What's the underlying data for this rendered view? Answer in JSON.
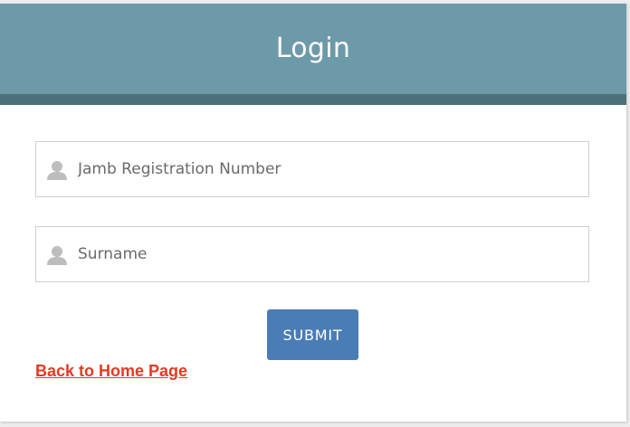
{
  "header": {
    "title": "Login"
  },
  "form": {
    "fields": [
      {
        "placeholder": "Jamb Registration Number",
        "value": "",
        "icon": "user-icon"
      },
      {
        "placeholder": "Surname",
        "value": "",
        "icon": "user-icon"
      }
    ],
    "submit_label": "SUBMIT"
  },
  "links": {
    "back_label": "Back to Home Page"
  },
  "colors": {
    "header": "#6d9aa9",
    "header_band": "#4d6f7a",
    "submit": "#4a7cb5",
    "link": "#e53a1f"
  }
}
